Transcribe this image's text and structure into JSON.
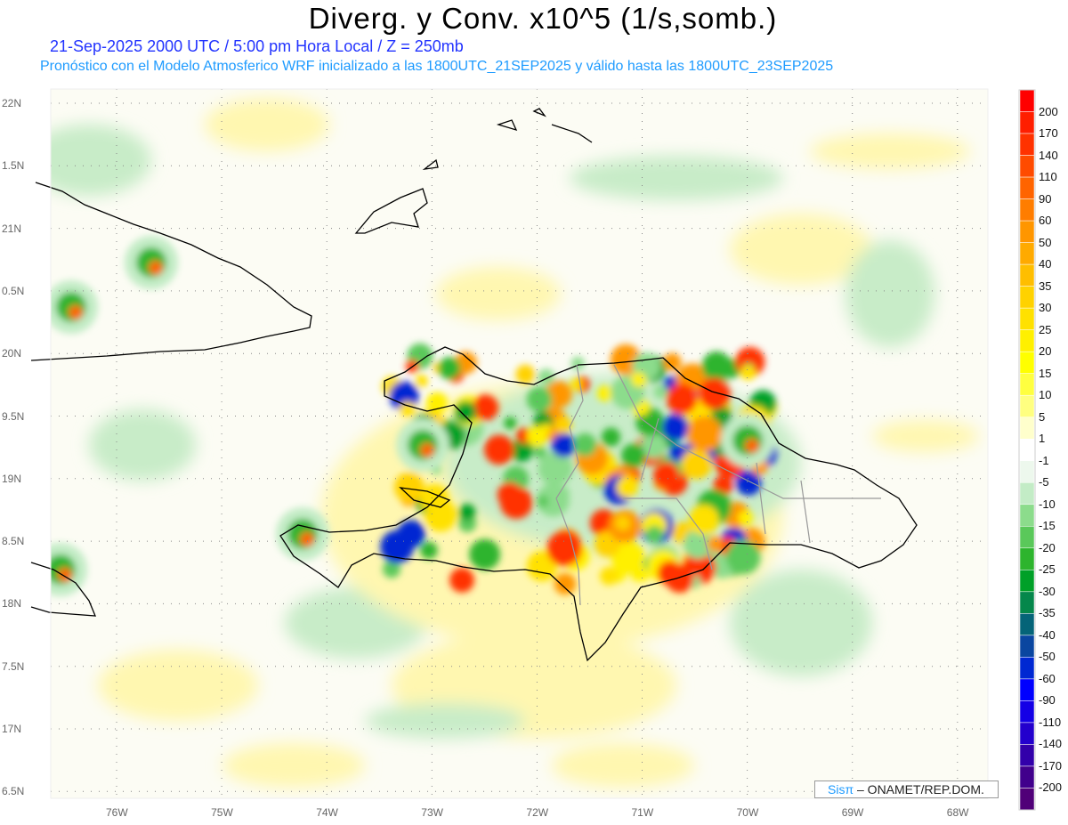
{
  "title": "Diverg. y Conv. x10^5 (1/s,somb.)",
  "subtitle_time": "21-Sep-2025  2000 UTC / 5:00 pm Hora Local / Z = 250mb",
  "subtitle_model": "Pronóstico con el Modelo Atmosferico WRF inicializado a las 1800UTC_21SEP2025 y válido hasta las  1800UTC_23SEP2025",
  "lat_labels": [
    "22N",
    "1.5N",
    "21N",
    "0.5N",
    "20N",
    "9.5N",
    "19N",
    "8.5N",
    "18N",
    "7.5N",
    "17N",
    "6.5N"
  ],
  "lon_labels": [
    "76W",
    "75W",
    "74W",
    "73W",
    "72W",
    "71W",
    "70W",
    "69W",
    "68W"
  ],
  "colorbar": {
    "labels": [
      "200",
      "170",
      "140",
      "110",
      "90",
      "60",
      "50",
      "40",
      "35",
      "30",
      "25",
      "20",
      "15",
      "10",
      "5",
      "1",
      "-1",
      "-5",
      "-10",
      "-15",
      "-20",
      "-25",
      "-30",
      "-35",
      "-40",
      "-50",
      "-60",
      "-90",
      "-110",
      "-140",
      "-170",
      "-200"
    ],
    "colors": [
      "#ff0000",
      "#ff1e00",
      "#ff3200",
      "#ff4b00",
      "#ff6400",
      "#ff7d00",
      "#ff9600",
      "#ffaa00",
      "#ffbe00",
      "#ffd200",
      "#ffe100",
      "#fff000",
      "#ffff00",
      "#ffff40",
      "#ffff80",
      "#ffffcc",
      "#ffffff",
      "#edf8ed",
      "#c3ecc6",
      "#8cdc8c",
      "#5ac85a",
      "#2db42d",
      "#00a028",
      "#05874b",
      "#056478",
      "#0a46a0",
      "#0028d2",
      "#0000ff",
      "#1400e6",
      "#2300cd",
      "#3200aa",
      "#41008c",
      "#500078"
    ]
  },
  "credit": {
    "brand": "Sisπ",
    "text": " –  ONAMET/REP.DOM."
  }
}
